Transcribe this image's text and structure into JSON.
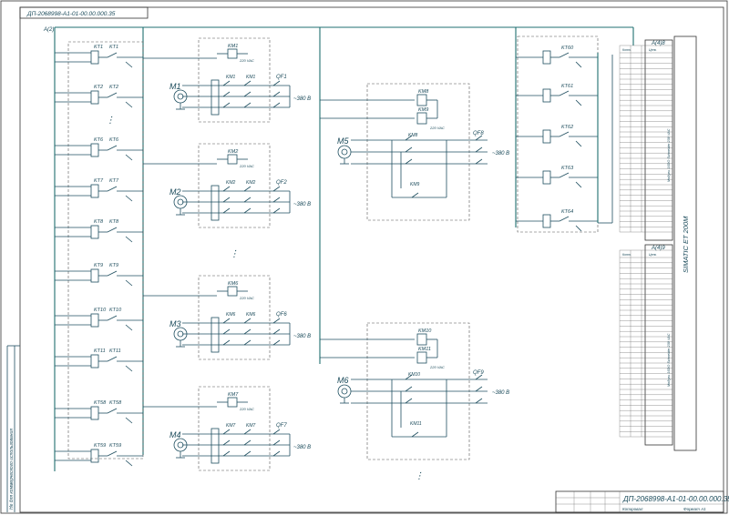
{
  "sheet": {
    "top_stamp": "ДП-2068998-A1-01-00.00.000.35",
    "title_code": "ДП-2068998-A1-01-00.00.000.35",
    "format": "Формат  А1",
    "copied": "Копировал",
    "side_text": "Не для коммерческого использования",
    "bus_label": "A(2)"
  },
  "relays_left": {
    "labels": [
      "KT1",
      "KT2",
      "KT6",
      "KT7",
      "KT8",
      "KT9",
      "KT10",
      "KT11",
      "KT58",
      "KT59"
    ],
    "ellipsis": "⋮"
  },
  "relays_right": {
    "labels": [
      "KT60",
      "KT61",
      "KT62",
      "KT63",
      "KT64"
    ]
  },
  "motors": [
    {
      "name": "M1",
      "contactor": "KM1",
      "coil": "KM1",
      "breaker": "QF1",
      "voltage": "~380 В",
      "coil_voltage": "220 VAC"
    },
    {
      "name": "M2",
      "contactor": "KM2",
      "coil": "KM2",
      "breaker": "QF2",
      "voltage": "~380 В",
      "coil_voltage": "220 VAC"
    },
    {
      "name": "M3",
      "contactor": "KM6",
      "coil": "KM6",
      "breaker": "QF6",
      "voltage": "~380 В",
      "coil_voltage": "220 VAC"
    },
    {
      "name": "M4",
      "contactor": "KM7",
      "coil": "KM7",
      "breaker": "QF7",
      "voltage": "~380 В",
      "coil_voltage": "220 VAC"
    }
  ],
  "reversing_motors": [
    {
      "name": "M5",
      "coil_a": "KM8",
      "coil_b": "KM9",
      "contact_a": "KM8",
      "contact_b": "KM9",
      "breaker": "QF8",
      "voltage": "~380 В",
      "coil_voltage": "220 VAC"
    },
    {
      "name": "M6",
      "coil_a": "KM10",
      "coil_b": "KM11",
      "contact_a": "KM10",
      "contact_b": "KM11",
      "breaker": "QF9",
      "voltage": "~380 В",
      "coil_voltage": "220 VAC"
    }
  ],
  "modules": [
    {
      "name": "A(4)8",
      "side_label": "Модуль 16DO Schneider 230 VAC",
      "header": [
        "Конт.",
        "Цепь"
      ]
    },
    {
      "name": "A(4)9",
      "side_label": "Модуль 16DO Schneider 230 VAC",
      "header": [
        "Конт.",
        "Цепь"
      ]
    }
  ],
  "plc_label": "SIMATIC ET 200M",
  "ellipsis": "⋮"
}
